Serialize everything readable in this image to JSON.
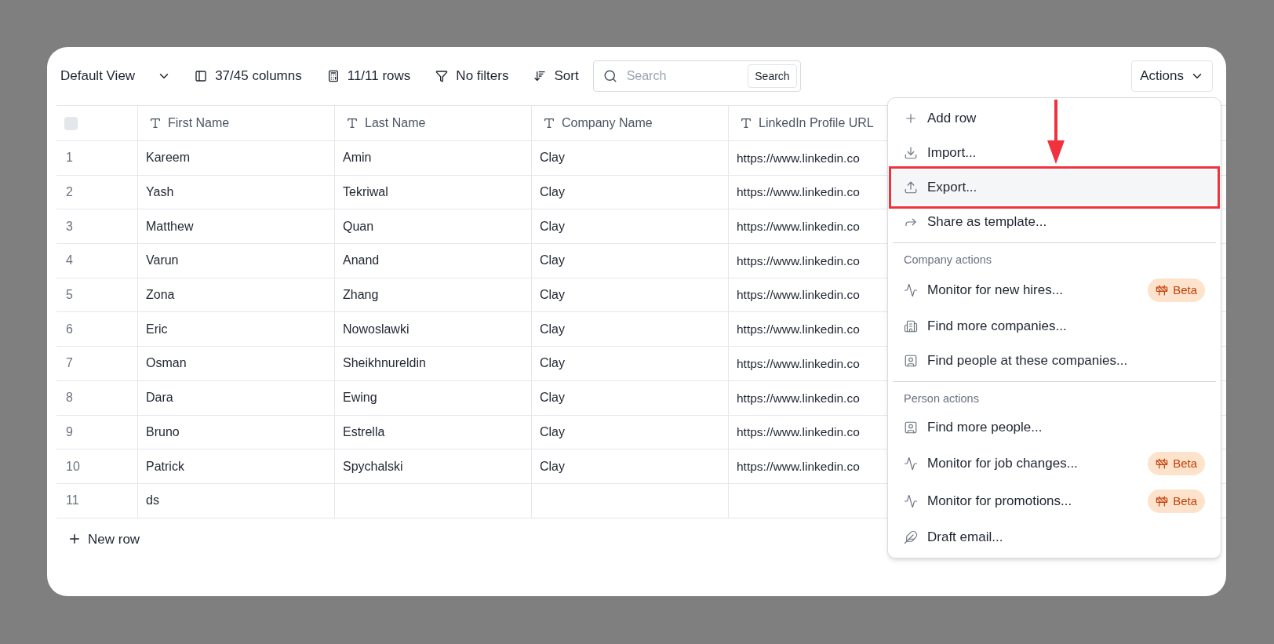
{
  "toolbar": {
    "view": "Default View",
    "items": [
      {
        "kind": "columns",
        "label": "37/45 columns"
      },
      {
        "kind": "rows",
        "label": "11/11 rows"
      },
      {
        "kind": "filter",
        "label": "No filters"
      },
      {
        "kind": "sort",
        "label": "Sort"
      }
    ],
    "search": {
      "placeholder": "Search",
      "button": "Search"
    },
    "actions": "Actions"
  },
  "table": {
    "select_all": {
      "checked": false
    },
    "columns": [
      "First Name",
      "Last Name",
      "Company Name",
      "LinkedIn Profile URL"
    ],
    "rows": [
      {
        "number": "1",
        "cells": [
          "Kareem",
          "Amin",
          "Clay",
          "https://www.linkedin.co"
        ]
      },
      {
        "number": "2",
        "cells": [
          "Yash",
          "Tekriwal",
          "Clay",
          "https://www.linkedin.co"
        ]
      },
      {
        "number": "3",
        "cells": [
          "Matthew",
          "Quan",
          "Clay",
          "https://www.linkedin.co"
        ]
      },
      {
        "number": "4",
        "cells": [
          "Varun",
          "Anand",
          "Clay",
          "https://www.linkedin.co"
        ]
      },
      {
        "number": "5",
        "cells": [
          "Zona",
          "Zhang",
          "Clay",
          "https://www.linkedin.co"
        ]
      },
      {
        "number": "6",
        "cells": [
          "Eric",
          "Nowoslawki",
          "Clay",
          "https://www.linkedin.co"
        ]
      },
      {
        "number": "7",
        "cells": [
          "Osman",
          "Sheikhnureldin",
          "Clay",
          "https://www.linkedin.co"
        ]
      },
      {
        "number": "8",
        "cells": [
          "Dara",
          "Ewing",
          "Clay",
          "https://www.linkedin.co"
        ]
      },
      {
        "number": "9",
        "cells": [
          "Bruno",
          "Estrella",
          "Clay",
          "https://www.linkedin.co"
        ]
      },
      {
        "number": "10",
        "cells": [
          "Patrick",
          "Spychalski",
          "Clay",
          "https://www.linkedin.co"
        ]
      },
      {
        "number": "11",
        "cells": [
          "ds",
          "",
          "",
          ""
        ]
      }
    ],
    "new_row": "New row"
  },
  "menu": {
    "sections": [
      {
        "items": [
          {
            "kind": "add",
            "label": "Add row",
            "highlighted": false
          },
          {
            "kind": "import",
            "label": "Import...",
            "highlighted": false
          },
          {
            "kind": "export",
            "label": "Export...",
            "highlighted": true
          },
          {
            "kind": "share",
            "label": "Share as template...",
            "highlighted": false
          }
        ]
      },
      {
        "heading": "Company actions",
        "items": [
          {
            "kind": "monitor",
            "label": "Monitor for new hires...",
            "badge": "Beta",
            "highlighted": false
          },
          {
            "kind": "building",
            "label": "Find more companies...",
            "highlighted": false
          },
          {
            "kind": "person",
            "label": "Find people at these companies...",
            "highlighted": false
          }
        ]
      },
      {
        "heading": "Person actions",
        "items": [
          {
            "kind": "person",
            "label": "Find more people...",
            "highlighted": false
          },
          {
            "kind": "monitor",
            "label": "Monitor for job changes...",
            "badge": "Beta",
            "highlighted": false
          },
          {
            "kind": "monitor",
            "label": "Monitor for promotions...",
            "badge": "Beta",
            "highlighted": false
          },
          {
            "kind": "feather",
            "label": "Draft email...",
            "highlighted": false
          }
        ]
      }
    ]
  }
}
